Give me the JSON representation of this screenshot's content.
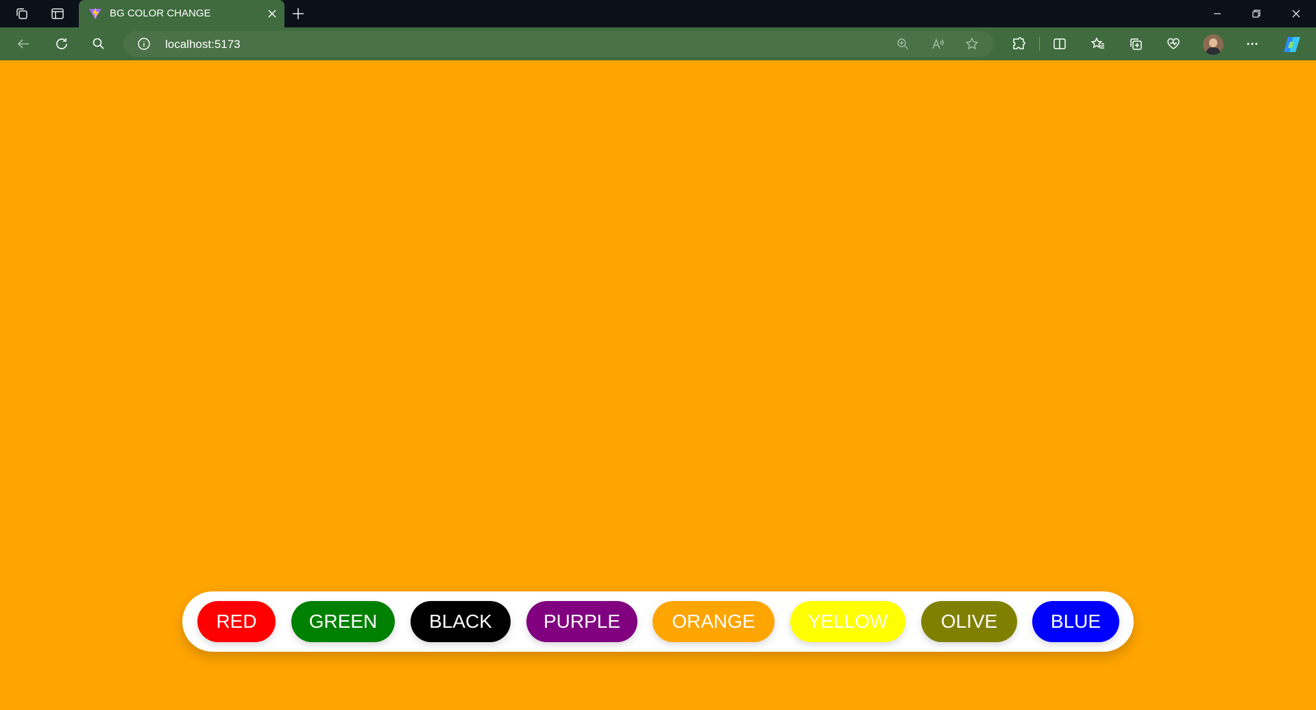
{
  "browser": {
    "tab": {
      "title": "BG COLOR CHANGE"
    },
    "address": {
      "url": "localhost:5173"
    },
    "icons": {
      "titlebar": [
        "workspaces-icon",
        "tab-actions-icon",
        "new-tab-icon",
        "minimize-icon",
        "restore-icon",
        "close-window-icon"
      ],
      "toolbar": [
        "back-icon",
        "refresh-icon",
        "search-icon",
        "site-info-icon",
        "zoom-icon",
        "read-aloud-icon",
        "favorite-star-icon",
        "extensions-icon",
        "split-screen-icon",
        "favorites-icon",
        "collections-icon",
        "browser-essentials-icon",
        "profile-avatar",
        "more-icon",
        "copilot-icon"
      ]
    }
  },
  "page": {
    "background_color": "#ffa500",
    "buttons": [
      {
        "label": "RED",
        "color": "#ff0000"
      },
      {
        "label": "GREEN",
        "color": "#008000"
      },
      {
        "label": "BLACK",
        "color": "#000000"
      },
      {
        "label": "PURPLE",
        "color": "#800080"
      },
      {
        "label": "ORANGE",
        "color": "#ffa500"
      },
      {
        "label": "YELLOW",
        "color": "#ffff00"
      },
      {
        "label": "OLIVE",
        "color": "#808000"
      },
      {
        "label": "BLUE",
        "color": "#0000ff"
      }
    ]
  }
}
